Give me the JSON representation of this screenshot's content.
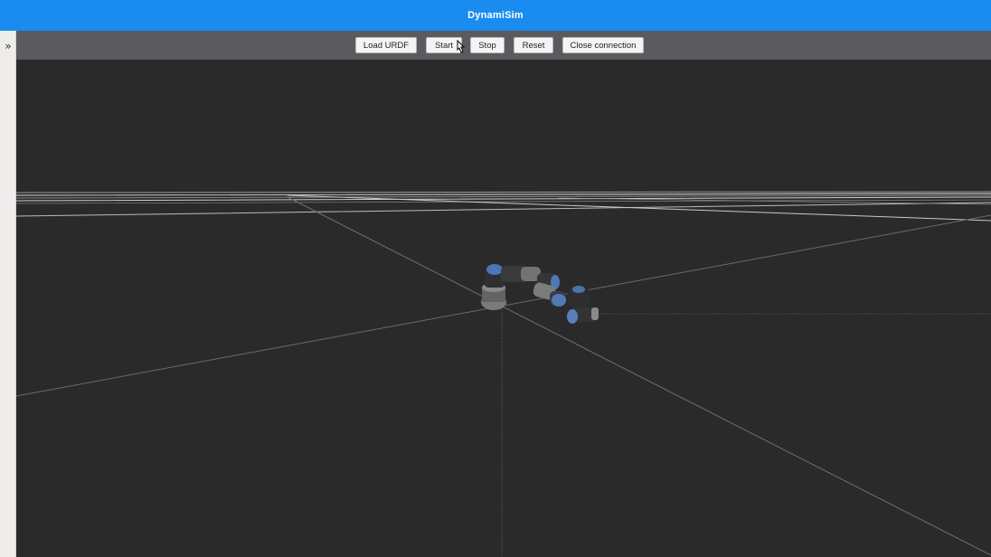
{
  "header": {
    "title": "DynamiSim",
    "color": "#1a8cf0"
  },
  "sidebar": {
    "toggle_label": "»"
  },
  "toolbar": {
    "load_label": "Load URDF",
    "start_label": "Start",
    "stop_label": "Stop",
    "reset_label": "Reset",
    "close_label": "Close connection"
  },
  "viewport": {
    "background": "#2a2a2a",
    "icons": [
      "grid-plane",
      "robot-arm-model",
      "pointer-cursor-icon"
    ]
  }
}
